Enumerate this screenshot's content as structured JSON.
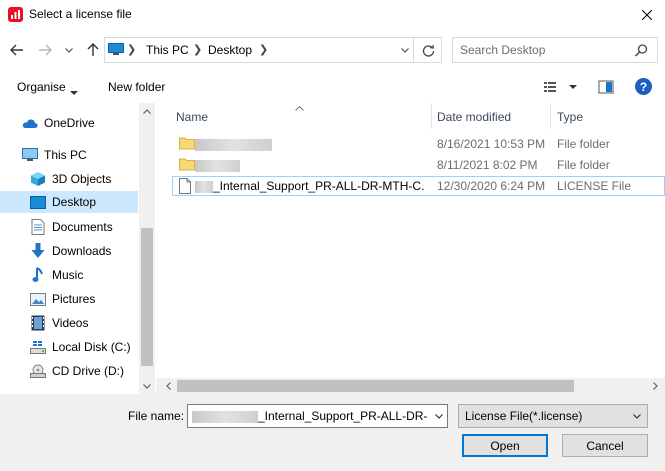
{
  "window": {
    "title": "Select a license file",
    "close_icon": "close-icon"
  },
  "nav": {
    "address": {
      "root": "This PC",
      "folder": "Desktop"
    },
    "search": {
      "placeholder": "Search Desktop"
    }
  },
  "toolbar": {
    "organise_label": "Organise",
    "new_folder_label": "New folder"
  },
  "sidebar": {
    "items": [
      {
        "label": "OneDrive",
        "icon": "cloud-icon"
      },
      {
        "label": "This PC",
        "icon": "computer-icon"
      },
      {
        "label": "3D Objects",
        "icon": "cube-icon"
      },
      {
        "label": "Desktop",
        "icon": "desktop-icon",
        "selected": true
      },
      {
        "label": "Documents",
        "icon": "document-icon"
      },
      {
        "label": "Downloads",
        "icon": "download-icon"
      },
      {
        "label": "Music",
        "icon": "music-icon"
      },
      {
        "label": "Pictures",
        "icon": "pictures-icon"
      },
      {
        "label": "Videos",
        "icon": "video-icon"
      },
      {
        "label": "Local Disk (C:)",
        "icon": "drive-icon"
      },
      {
        "label": "CD Drive (D:)",
        "icon": "cd-drive-icon"
      }
    ]
  },
  "filelist": {
    "columns": {
      "name": "Name",
      "date": "Date modified",
      "type": "Type"
    },
    "rows": [
      {
        "name": "",
        "date": "8/16/2021 10:53 PM",
        "type": "File folder",
        "icon": "folder-icon"
      },
      {
        "name": "",
        "date": "8/11/2021 8:02 PM",
        "type": "File folder",
        "icon": "folder-icon"
      },
      {
        "name": "_Internal_Support_PR-ALL-DR-MTH-C...",
        "date": "12/30/2020 6:24 PM",
        "type": "LICENSE File",
        "icon": "file-icon"
      }
    ]
  },
  "bottom": {
    "filename_label": "File name:",
    "filename_value": "_Internal_Support_PR-ALL-DR-MTH",
    "filetype_value": "License File(*.license)",
    "open_label": "Open",
    "cancel_label": "Cancel"
  },
  "colors": {
    "accent": "#0078d7",
    "selection": "#cce8ff",
    "folder": "#f8d775"
  }
}
